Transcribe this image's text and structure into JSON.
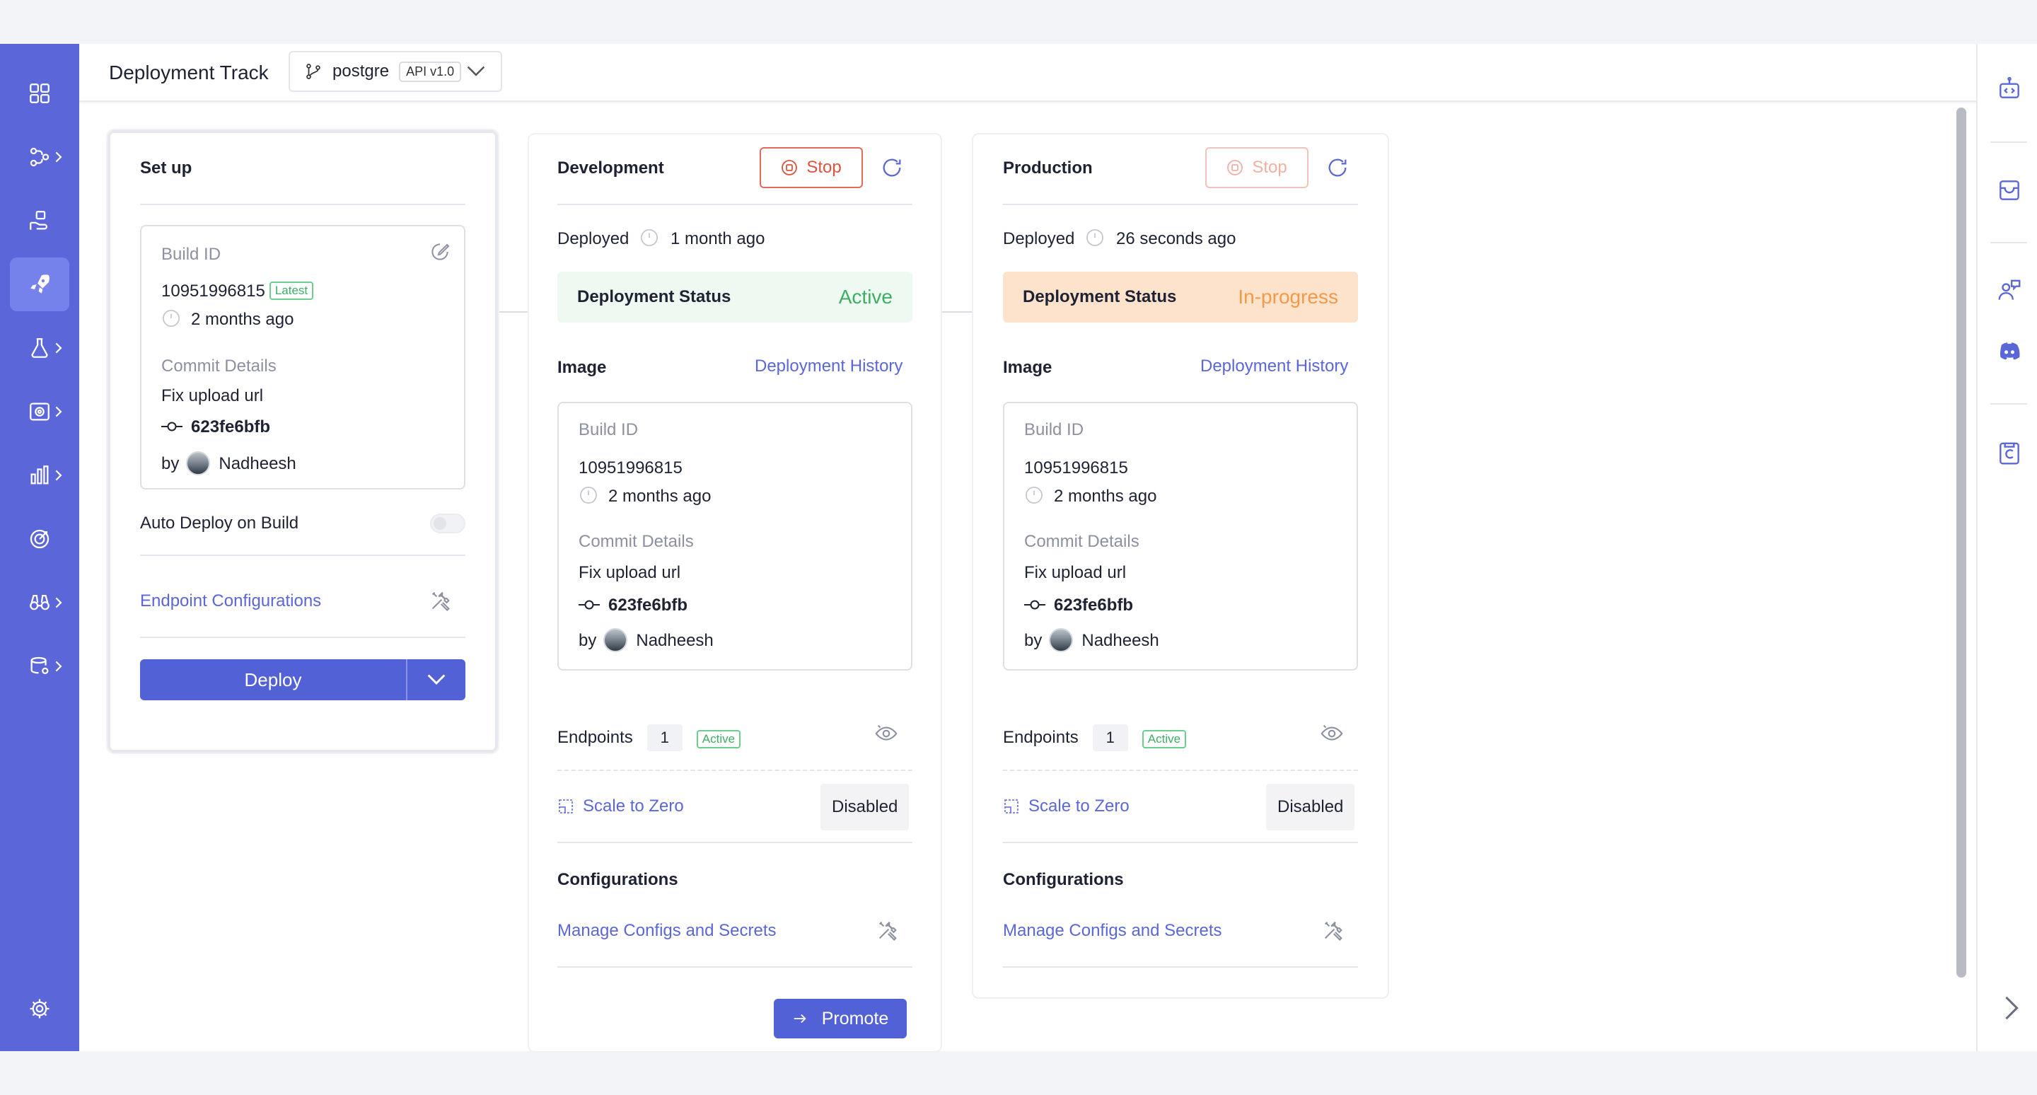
{
  "header": {
    "title": "Deployment Track",
    "branch": "postgre",
    "api_version": "API v1.0"
  },
  "sidebar": {
    "items": [
      {
        "name": "overview",
        "icon": "grid-icon",
        "has_submenu": false
      },
      {
        "name": "develop",
        "icon": "flow-icon",
        "has_submenu": true
      },
      {
        "name": "build",
        "icon": "hand-box-icon",
        "has_submenu": false
      },
      {
        "name": "deploy",
        "icon": "rocket-icon",
        "has_submenu": false,
        "active": true
      },
      {
        "name": "test",
        "icon": "flask-icon",
        "has_submenu": true
      },
      {
        "name": "manage",
        "icon": "settings-gear-box-icon",
        "has_submenu": true
      },
      {
        "name": "observability",
        "icon": "bar-chart-icon",
        "has_submenu": true
      },
      {
        "name": "insights",
        "icon": "target-icon",
        "has_submenu": true
      },
      {
        "name": "governance",
        "icon": "binoculars-icon",
        "has_submenu": true
      },
      {
        "name": "dependencies",
        "icon": "database-gear-icon",
        "has_submenu": true
      }
    ],
    "settings_icon": "gear-icon"
  },
  "setup": {
    "title": "Set up",
    "build_id_label": "Build ID",
    "build_id": "10951996815",
    "latest_badge": "Latest",
    "build_time": "2 months ago",
    "commit_label": "Commit Details",
    "commit_message": "Fix upload url",
    "commit_hash": "623fe6bfb",
    "by_label": "by",
    "author": "Nadheesh",
    "auto_deploy_label": "Auto Deploy on Build",
    "auto_deploy_enabled": false,
    "endpoint_config_label": "Endpoint Configurations",
    "deploy_label": "Deploy"
  },
  "environments": [
    {
      "key": "dev",
      "title": "Development",
      "stop_label": "Stop",
      "deployed_label": "Deployed",
      "deployed_time": "1 month ago",
      "status_label": "Deployment Status",
      "status_value": "Active",
      "image_label": "Image",
      "history_link": "Deployment History",
      "build_id_label": "Build ID",
      "build_id": "10951996815",
      "build_time": "2 months ago",
      "commit_label": "Commit Details",
      "commit_message": "Fix upload url",
      "commit_hash": "623fe6bfb",
      "by_label": "by",
      "author": "Nadheesh",
      "endpoints_label": "Endpoints",
      "endpoints_count": "1",
      "endpoints_badge": "Active",
      "scale_label": "Scale to Zero",
      "scale_value": "Disabled",
      "config_title": "Configurations",
      "config_link": "Manage Configs and Secrets",
      "promote_label": "Promote"
    },
    {
      "key": "prod",
      "title": "Production",
      "stop_label": "Stop",
      "deployed_label": "Deployed",
      "deployed_time": "26 seconds ago",
      "status_label": "Deployment Status",
      "status_value": "In-progress",
      "image_label": "Image",
      "history_link": "Deployment History",
      "build_id_label": "Build ID",
      "build_id": "10951996815",
      "build_time": "2 months ago",
      "commit_label": "Commit Details",
      "commit_message": "Fix upload url",
      "commit_hash": "623fe6bfb",
      "by_label": "by",
      "author": "Nadheesh",
      "endpoints_label": "Endpoints",
      "endpoints_count": "1",
      "endpoints_badge": "Active",
      "scale_label": "Scale to Zero",
      "scale_value": "Disabled",
      "config_title": "Configurations",
      "config_link": "Manage Configs and Secrets"
    }
  ],
  "rightbar": {
    "icons": [
      "robot-code-icon",
      "inbox-icon",
      "support-chat-icon",
      "discord-icon",
      "copyright-doc-icon",
      "chevron-right-icon"
    ]
  },
  "colors": {
    "primary": "#5b67d8",
    "active_green": "#3dae63",
    "progress_orange": "#f29a4a",
    "stop_red": "#e0523f"
  }
}
